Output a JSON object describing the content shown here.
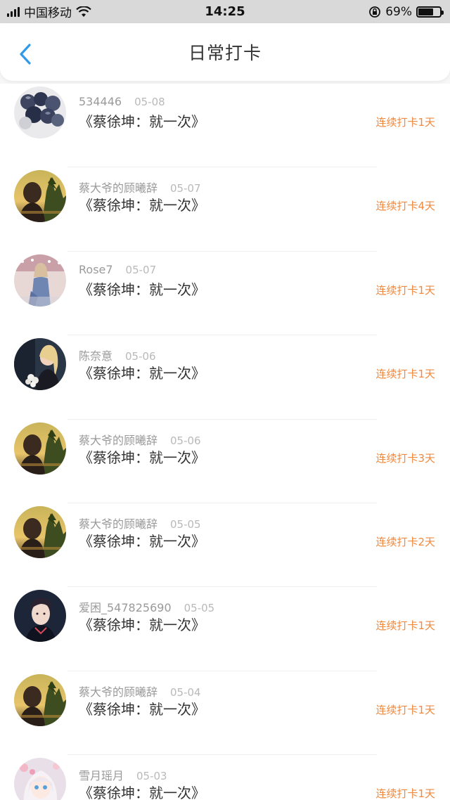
{
  "status_bar": {
    "carrier": "中国移动",
    "time": "14:25",
    "battery": "69%",
    "battery_level": 0.69
  },
  "header": {
    "title": "日常打卡",
    "back_icon": "chevron-left-icon",
    "accent_color": "#2f9be8"
  },
  "colors": {
    "streak": "#f0883e",
    "username": "#9a9a9a",
    "date": "#b9b9b9"
  },
  "records": [
    {
      "username": "534446",
      "date": "05-08",
      "book": "《蔡徐坤：就一次》",
      "streak": "连续打卡1天",
      "avatar": "roses"
    },
    {
      "username": "蔡大爷的顾曦辞",
      "date": "05-07",
      "book": "《蔡徐坤：就一次》",
      "streak": "连续打卡4天",
      "avatar": "sunset"
    },
    {
      "username": "Rose7",
      "date": "05-07",
      "book": "《蔡徐坤：就一次》",
      "streak": "连续打卡1天",
      "avatar": "woman-denim"
    },
    {
      "username": "陈奈意",
      "date": "05-06",
      "book": "《蔡徐坤：就一次》",
      "streak": "连续打卡1天",
      "avatar": "blonde-woman"
    },
    {
      "username": "蔡大爷的顾曦辞",
      "date": "05-06",
      "book": "《蔡徐坤：就一次》",
      "streak": "连续打卡3天",
      "avatar": "sunset"
    },
    {
      "username": "蔡大爷的顾曦辞",
      "date": "05-05",
      "book": "《蔡徐坤：就一次》",
      "streak": "连续打卡2天",
      "avatar": "sunset"
    },
    {
      "username": "爱困_547825690",
      "date": "05-05",
      "book": "《蔡徐坤：就一次》",
      "streak": "连续打卡1天",
      "avatar": "man-dark"
    },
    {
      "username": "蔡大爷的顾曦辞",
      "date": "05-04",
      "book": "《蔡徐坤：就一次》",
      "streak": "连续打卡1天",
      "avatar": "sunset"
    },
    {
      "username": "雪月瑶月",
      "date": "05-03",
      "book": "《蔡徐坤：就一次》",
      "streak": "连续打卡1天",
      "avatar": "anime-girl"
    }
  ]
}
